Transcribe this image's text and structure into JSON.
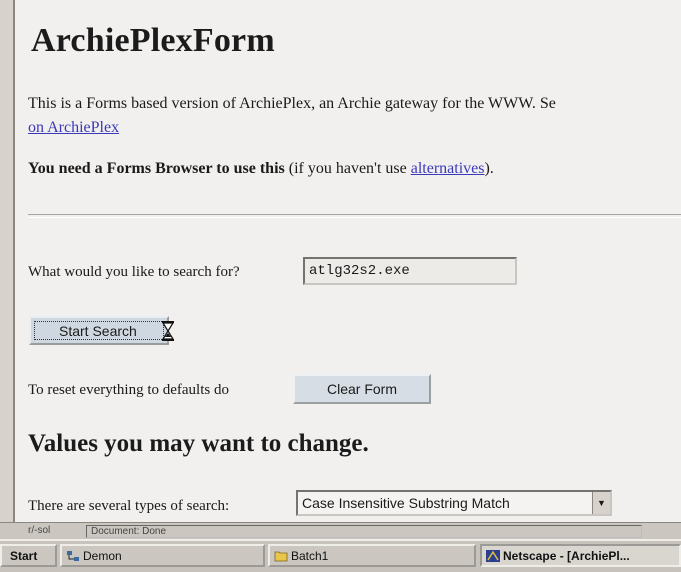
{
  "page": {
    "title": "ArchiePlexForm",
    "intro_line1": "This is a Forms based version of ArchiePlex, an Archie gateway for the WWW. Se",
    "intro_link": "on ArchiePlex",
    "need_bold": "You need a Forms Browser to use this",
    "need_text": " (if you haven't use ",
    "need_link": "alternatives",
    "need_end": ")."
  },
  "search": {
    "label": "What would you like to search for?",
    "value": "atlg32s2.exe",
    "start_label": "Start Search"
  },
  "reset": {
    "label": "To reset everything to defaults do",
    "clear_label": "Clear Form"
  },
  "section": {
    "heading": "Values you may want to change.",
    "type_label": "There are several types of search:",
    "type_value": "Case Insensitive Substring Match"
  },
  "statusbar": {
    "icon_text": "r/-sol",
    "text": "Document: Done"
  },
  "taskbar": {
    "start": "Start",
    "item1": "Demon",
    "item2": "Batch1",
    "item3": "Netscape - [ArchiePl..."
  },
  "colors": {
    "link": "#3a3ab8",
    "background": "#f1f0ef",
    "button": "#cfd8e0"
  }
}
